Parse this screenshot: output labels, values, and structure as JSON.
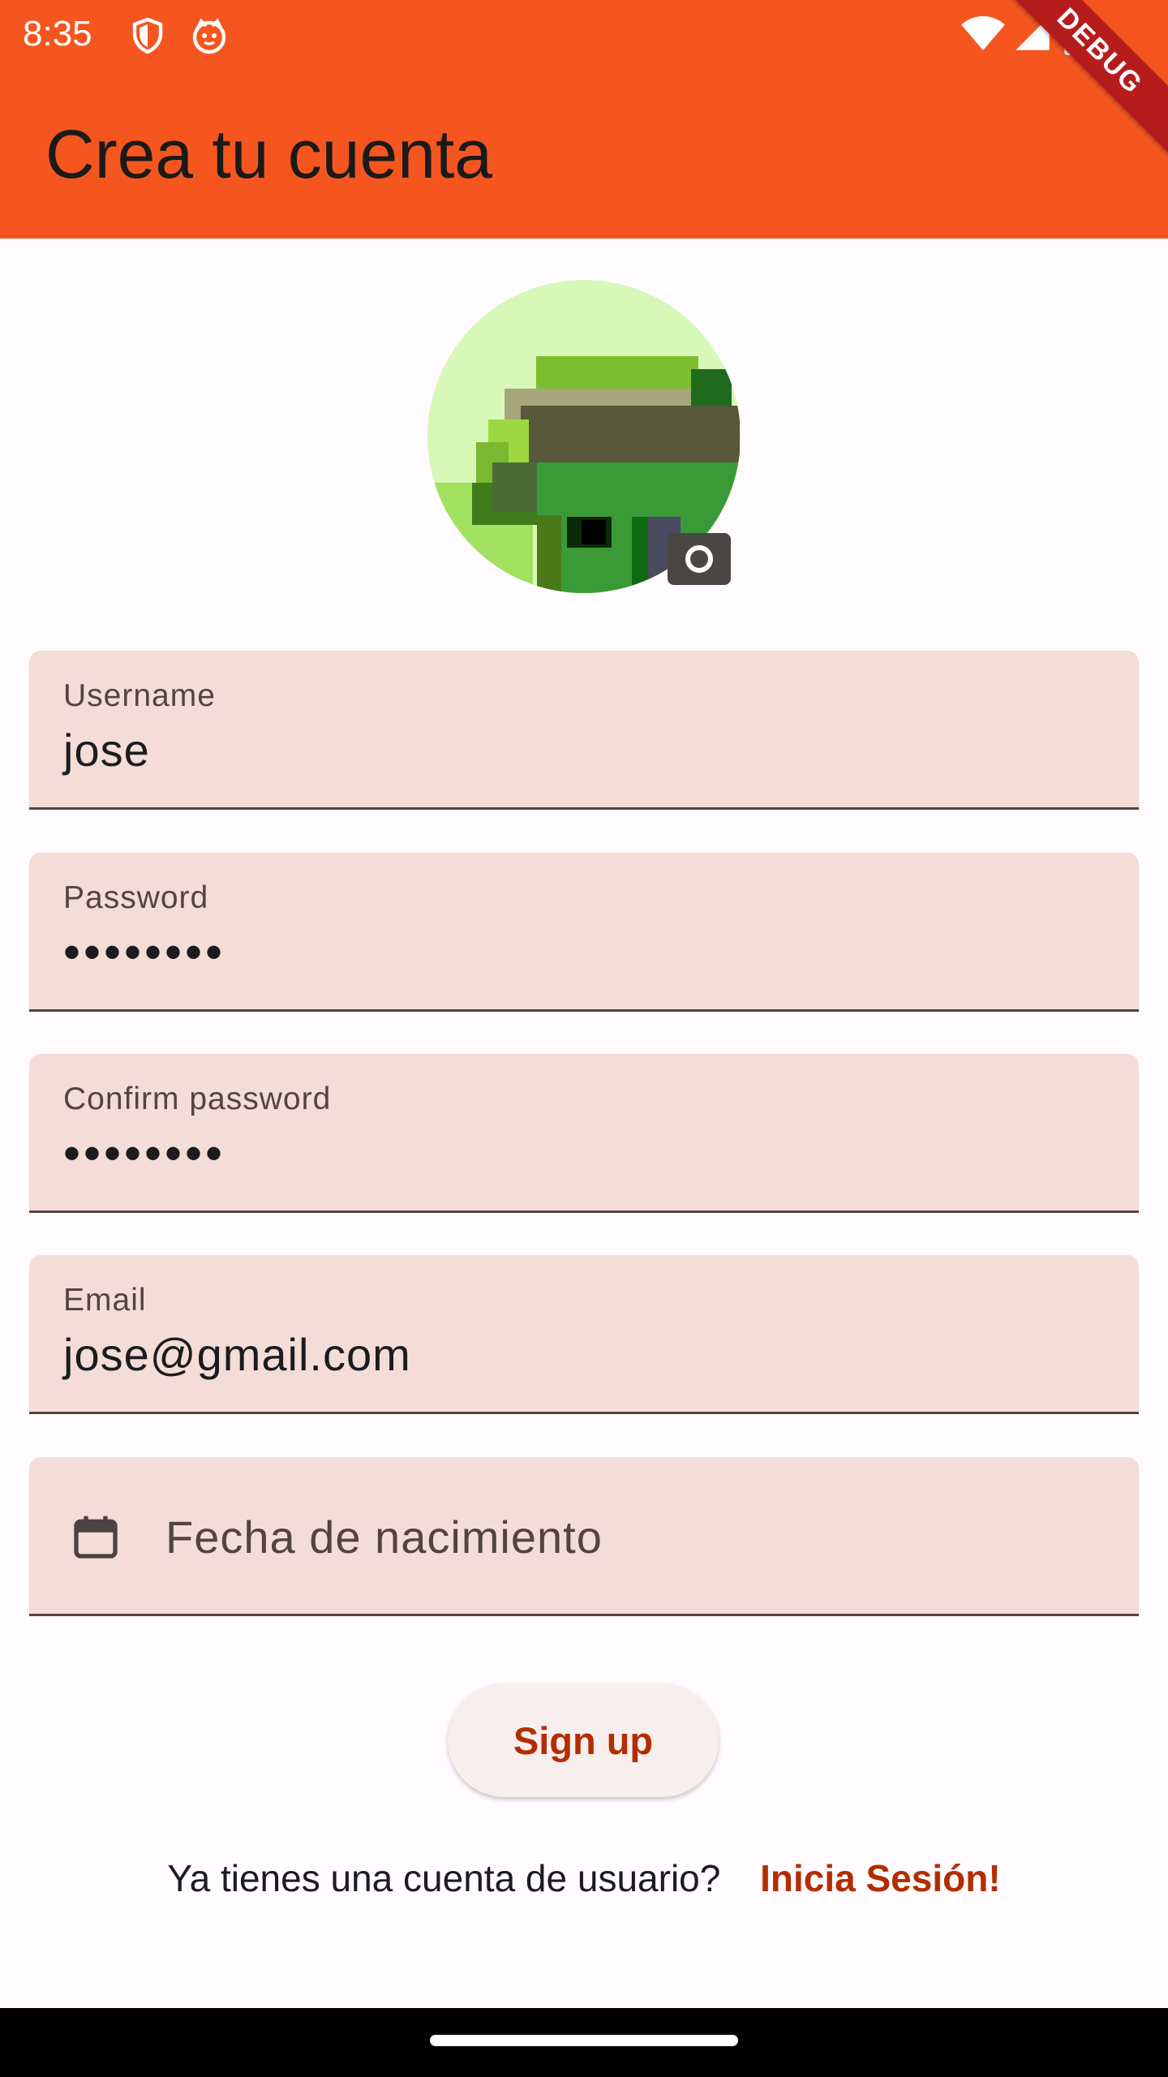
{
  "status_bar": {
    "time": "8:35",
    "icons": [
      "shield-icon",
      "cat-notification-icon",
      "wifi-icon",
      "signal-icon",
      "battery-icon"
    ],
    "debug_label": "DEBUG"
  },
  "app_bar": {
    "title": "Crea tu cuenta",
    "color": "#f5561f"
  },
  "avatar": {
    "icon": "pixel-avatar-image",
    "badge_icon": "camera-icon"
  },
  "form": {
    "username": {
      "label": "Username",
      "value": "jose"
    },
    "password": {
      "label": "Password",
      "value": "••••••••"
    },
    "confirm_password": {
      "label": "Confirm password",
      "value": "••••••••"
    },
    "email": {
      "label": "Email",
      "value": "jose@gmail.com"
    },
    "birthdate": {
      "placeholder": "Fecha de nacimiento",
      "icon": "calendar-icon"
    }
  },
  "signup_button": {
    "label": "Sign up"
  },
  "login_prompt": {
    "question": "Ya tienes una cuenta de usuario?",
    "link": "Inicia Sesión!"
  },
  "colors": {
    "accent": "#b32d00",
    "field_bg": "#f3ddd6",
    "background": "#fffbfe"
  }
}
